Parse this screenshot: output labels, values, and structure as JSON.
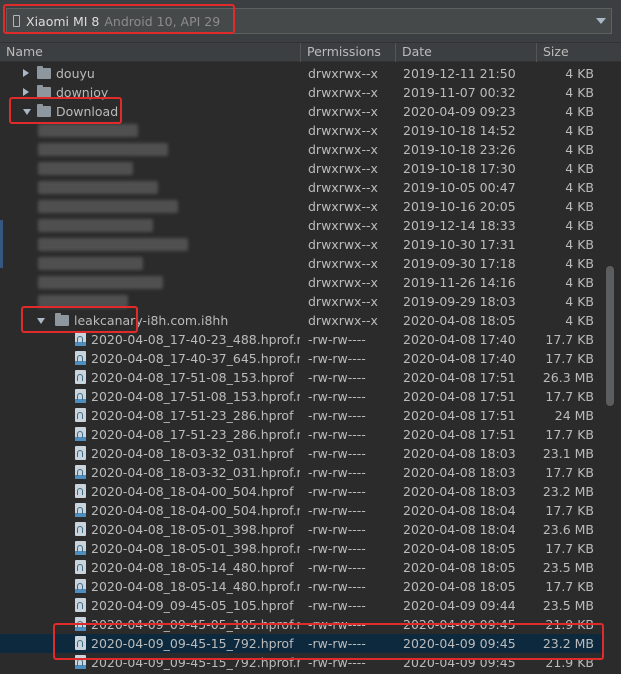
{
  "device": {
    "name": "Xiaomi MI 8",
    "api": "Android 10, API 29"
  },
  "columns": {
    "name": "Name",
    "permissions": "Permissions",
    "date": "Date",
    "size": "Size"
  },
  "rows": [
    {
      "name": "douyu",
      "perm": "drwxrwx--x",
      "date": "2019-12-11 21:50",
      "size": "4 KB",
      "type": "folder",
      "depth": 1,
      "arrow": "closed"
    },
    {
      "name": "downjoy",
      "perm": "drwxrwx--x",
      "date": "2019-11-07 00:32",
      "size": "4 KB",
      "type": "folder",
      "depth": 1,
      "arrow": "closed"
    },
    {
      "name": "Download",
      "perm": "drwxrwx--x",
      "date": "2020-04-09 09:23",
      "size": "4 KB",
      "type": "folder",
      "depth": 1,
      "arrow": "open"
    },
    {
      "name": "",
      "perm": "drwxrwx--x",
      "date": "2019-10-18 14:52",
      "size": "4 KB",
      "type": "blurred"
    },
    {
      "name": "",
      "perm": "drwxrwx--x",
      "date": "2019-10-18 23:26",
      "size": "4 KB",
      "type": "blurred"
    },
    {
      "name": "",
      "perm": "drwxrwx--x",
      "date": "2019-10-18 17:30",
      "size": "4 KB",
      "type": "blurred"
    },
    {
      "name": "",
      "perm": "drwxrwx--x",
      "date": "2019-10-05 00:47",
      "size": "4 KB",
      "type": "blurred"
    },
    {
      "name": "",
      "perm": "drwxrwx--x",
      "date": "2019-10-16 20:05",
      "size": "4 KB",
      "type": "blurred"
    },
    {
      "name": "",
      "perm": "drwxrwx--x",
      "date": "2019-12-14 18:33",
      "size": "4 KB",
      "type": "blurred"
    },
    {
      "name": "",
      "perm": "drwxrwx--x",
      "date": "2019-10-30 17:31",
      "size": "4 KB",
      "type": "blurred"
    },
    {
      "name": "",
      "perm": "drwxrwx--x",
      "date": "2019-09-30 17:18",
      "size": "4 KB",
      "type": "blurred"
    },
    {
      "name": "",
      "perm": "drwxrwx--x",
      "date": "2019-11-26 14:16",
      "size": "4 KB",
      "type": "blurred"
    },
    {
      "name": "",
      "perm": "drwxrwx--x",
      "date": "2019-09-29 18:03",
      "size": "4 KB",
      "type": "blurred"
    },
    {
      "name": "leakcanary-i8h.com.i8hh",
      "perm": "drwxrwx--x",
      "date": "2020-04-08 18:05",
      "size": "4 KB",
      "type": "folder",
      "depth": 2,
      "arrow": "open"
    },
    {
      "name": "2020-04-08_17-40-23_488.hprof.result",
      "perm": "-rw-rw----",
      "date": "2020-04-08 17:40",
      "size": "17.7 KB",
      "type": "result"
    },
    {
      "name": "2020-04-08_17-40-37_645.hprof.result",
      "perm": "-rw-rw----",
      "date": "2020-04-08 17:40",
      "size": "17.7 KB",
      "type": "result"
    },
    {
      "name": "2020-04-08_17-51-08_153.hprof",
      "perm": "-rw-rw----",
      "date": "2020-04-08 17:51",
      "size": "26.3 MB",
      "type": "hprof"
    },
    {
      "name": "2020-04-08_17-51-08_153.hprof.result",
      "perm": "-rw-rw----",
      "date": "2020-04-08 17:51",
      "size": "17.7 KB",
      "type": "result"
    },
    {
      "name": "2020-04-08_17-51-23_286.hprof",
      "perm": "-rw-rw----",
      "date": "2020-04-08 17:51",
      "size": "24 MB",
      "type": "hprof"
    },
    {
      "name": "2020-04-08_17-51-23_286.hprof.result",
      "perm": "-rw-rw----",
      "date": "2020-04-08 17:51",
      "size": "17.7 KB",
      "type": "result"
    },
    {
      "name": "2020-04-08_18-03-32_031.hprof",
      "perm": "-rw-rw----",
      "date": "2020-04-08 18:03",
      "size": "23.1 MB",
      "type": "hprof"
    },
    {
      "name": "2020-04-08_18-03-32_031.hprof.result",
      "perm": "-rw-rw----",
      "date": "2020-04-08 18:03",
      "size": "17.7 KB",
      "type": "result"
    },
    {
      "name": "2020-04-08_18-04-00_504.hprof",
      "perm": "-rw-rw----",
      "date": "2020-04-08 18:03",
      "size": "23.2 MB",
      "type": "hprof"
    },
    {
      "name": "2020-04-08_18-04-00_504.hprof.result",
      "perm": "-rw-rw----",
      "date": "2020-04-08 18:04",
      "size": "17.7 KB",
      "type": "result"
    },
    {
      "name": "2020-04-08_18-05-01_398.hprof",
      "perm": "-rw-rw----",
      "date": "2020-04-08 18:04",
      "size": "23.6 MB",
      "type": "hprof"
    },
    {
      "name": "2020-04-08_18-05-01_398.hprof.result",
      "perm": "-rw-rw----",
      "date": "2020-04-08 18:05",
      "size": "17.7 KB",
      "type": "result"
    },
    {
      "name": "2020-04-08_18-05-14_480.hprof",
      "perm": "-rw-rw----",
      "date": "2020-04-08 18:05",
      "size": "23.5 MB",
      "type": "hprof"
    },
    {
      "name": "2020-04-08_18-05-14_480.hprof.result",
      "perm": "-rw-rw----",
      "date": "2020-04-08 18:05",
      "size": "17.7 KB",
      "type": "result"
    },
    {
      "name": "2020-04-09_09-45-05_105.hprof",
      "perm": "-rw-rw----",
      "date": "2020-04-09 09:44",
      "size": "23.5 MB",
      "type": "hprof"
    },
    {
      "name": "2020-04-09_09-45-05_105.hprof.result",
      "perm": "-rw-rw----",
      "date": "2020-04-09 09:45",
      "size": "21.9 KB",
      "type": "result"
    },
    {
      "name": "2020-04-09_09-45-15_792.hprof",
      "perm": "-rw-rw----",
      "date": "2020-04-09 09:45",
      "size": "23.2 MB",
      "type": "hprof",
      "selected": true
    },
    {
      "name": "2020-04-09_09-45-15_792.hprof.result",
      "perm": "-rw-rw----",
      "date": "2020-04-09 09:45",
      "size": "21.9 KB",
      "type": "result"
    }
  ]
}
